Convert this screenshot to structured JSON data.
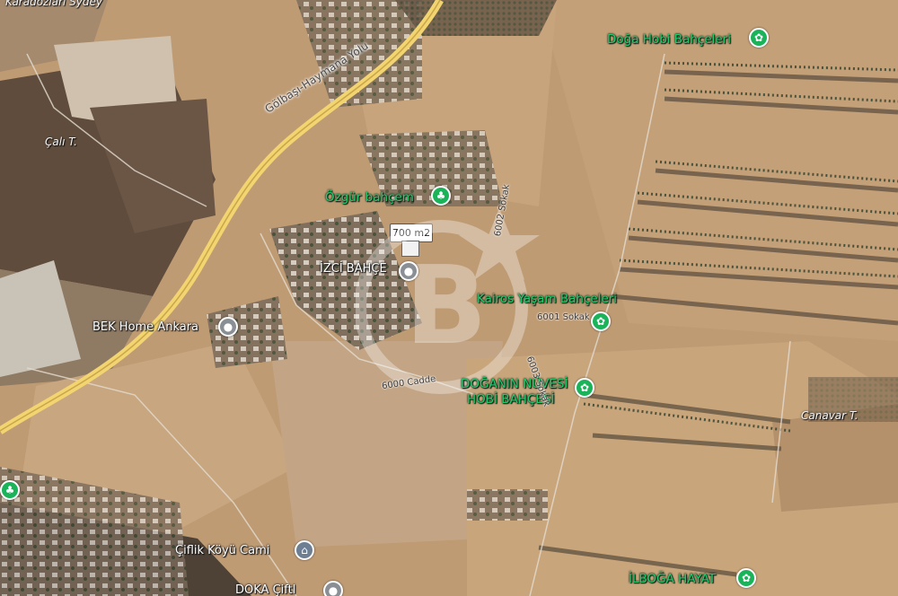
{
  "map": {
    "type": "satellite",
    "measurement": {
      "label": "700 m2"
    },
    "places": [
      {
        "key": "doga",
        "label": "Doğa Hobi Bahçeleri",
        "style": "green",
        "icon": "flower-icon"
      },
      {
        "key": "ozgur",
        "label": "Özgür bahçem",
        "style": "green",
        "icon": "tree-icon"
      },
      {
        "key": "izci",
        "label": "İZCİ BAHÇE",
        "style": "white",
        "icon": "location-pin-icon"
      },
      {
        "key": "kairos",
        "label": "Kairos Yaşam Bahçeleri",
        "style": "green",
        "icon": "flower-icon"
      },
      {
        "key": "bek",
        "label": "BEK Home Ankara",
        "style": "white",
        "icon": "location-pin-icon"
      },
      {
        "key": "doganin1",
        "label": "DOĞANIN NÜVESİ",
        "style": "green",
        "icon": "flower-icon"
      },
      {
        "key": "doganin2",
        "label": "HOBİ BAHÇESİ",
        "style": "green"
      },
      {
        "key": "ciflik",
        "label": "Çiflik Köyü Cami",
        "style": "white",
        "icon": "mosque-icon"
      },
      {
        "key": "ilboga",
        "label": "İLBOĞA HAYAT",
        "style": "green",
        "icon": "flower-icon"
      },
      {
        "key": "doka",
        "label": "DOKA Çiftl",
        "style": "white",
        "icon": "location-pin-icon"
      }
    ],
    "localities": {
      "cali": "Çalı T.",
      "canavar": "Canavar T.",
      "top_left": "Karadozlari Sydey"
    },
    "roads": {
      "highway": "Gölbaşı-Haymana Yolu",
      "cadde": "6000 Cadde",
      "sokak1": "6001 Sokak",
      "sokak2": "6002 Sokak",
      "sokak3": "6003 Sokak"
    },
    "colors": {
      "field": "#c9a57c",
      "dark_field": "#5e4a3a",
      "highway": "#f2d470",
      "green_label": "#1ecf72",
      "pin_green": "#1bb35a"
    }
  }
}
